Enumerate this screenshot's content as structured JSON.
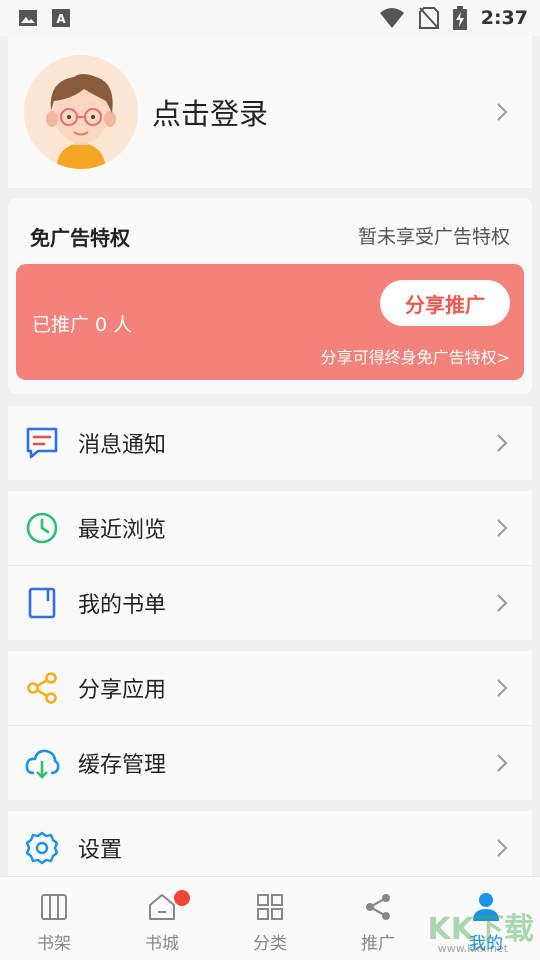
{
  "status_bar": {
    "time": "2:37",
    "icons": [
      "image-icon",
      "font-download-icon",
      "wifi-icon",
      "no-sim-icon",
      "battery-charging-icon"
    ]
  },
  "profile": {
    "login_label": "点击登录"
  },
  "ad_free": {
    "title": "免广告特权",
    "status": "暂未享受广告特权",
    "promoted_count": "已推广 0 人",
    "share_button": "分享推广",
    "hint": "分享可得终身免广告特权>"
  },
  "menu": [
    {
      "label": "消息通知",
      "icon": "message-icon",
      "color": "#2f6fe0"
    },
    {
      "label": "最近浏览",
      "icon": "clock-icon",
      "color": "#2fbf6f"
    },
    {
      "label": "我的书单",
      "icon": "book-icon",
      "color": "#2f6fe0"
    },
    {
      "label": "分享应用",
      "icon": "share-icon",
      "color": "#f2b01e"
    },
    {
      "label": "缓存管理",
      "icon": "cloud-download-icon",
      "color": "#1a93e8"
    },
    {
      "label": "设置",
      "icon": "settings-icon",
      "color": "#1a93e8"
    }
  ],
  "tabs": [
    {
      "label": "书架",
      "icon": "bookshelf-icon"
    },
    {
      "label": "书城",
      "icon": "home-icon",
      "badge": true
    },
    {
      "label": "分类",
      "icon": "category-icon"
    },
    {
      "label": "推广",
      "icon": "share-icon"
    },
    {
      "label": "我的",
      "icon": "person-icon",
      "active": true
    }
  ],
  "watermark": {
    "text": "KK下载",
    "url": "www.kkx.net"
  },
  "colors": {
    "banner": "#f4817a",
    "share_text": "#ef5a4e",
    "tab_active": "#1a93e8",
    "badge": "#f4433a"
  }
}
